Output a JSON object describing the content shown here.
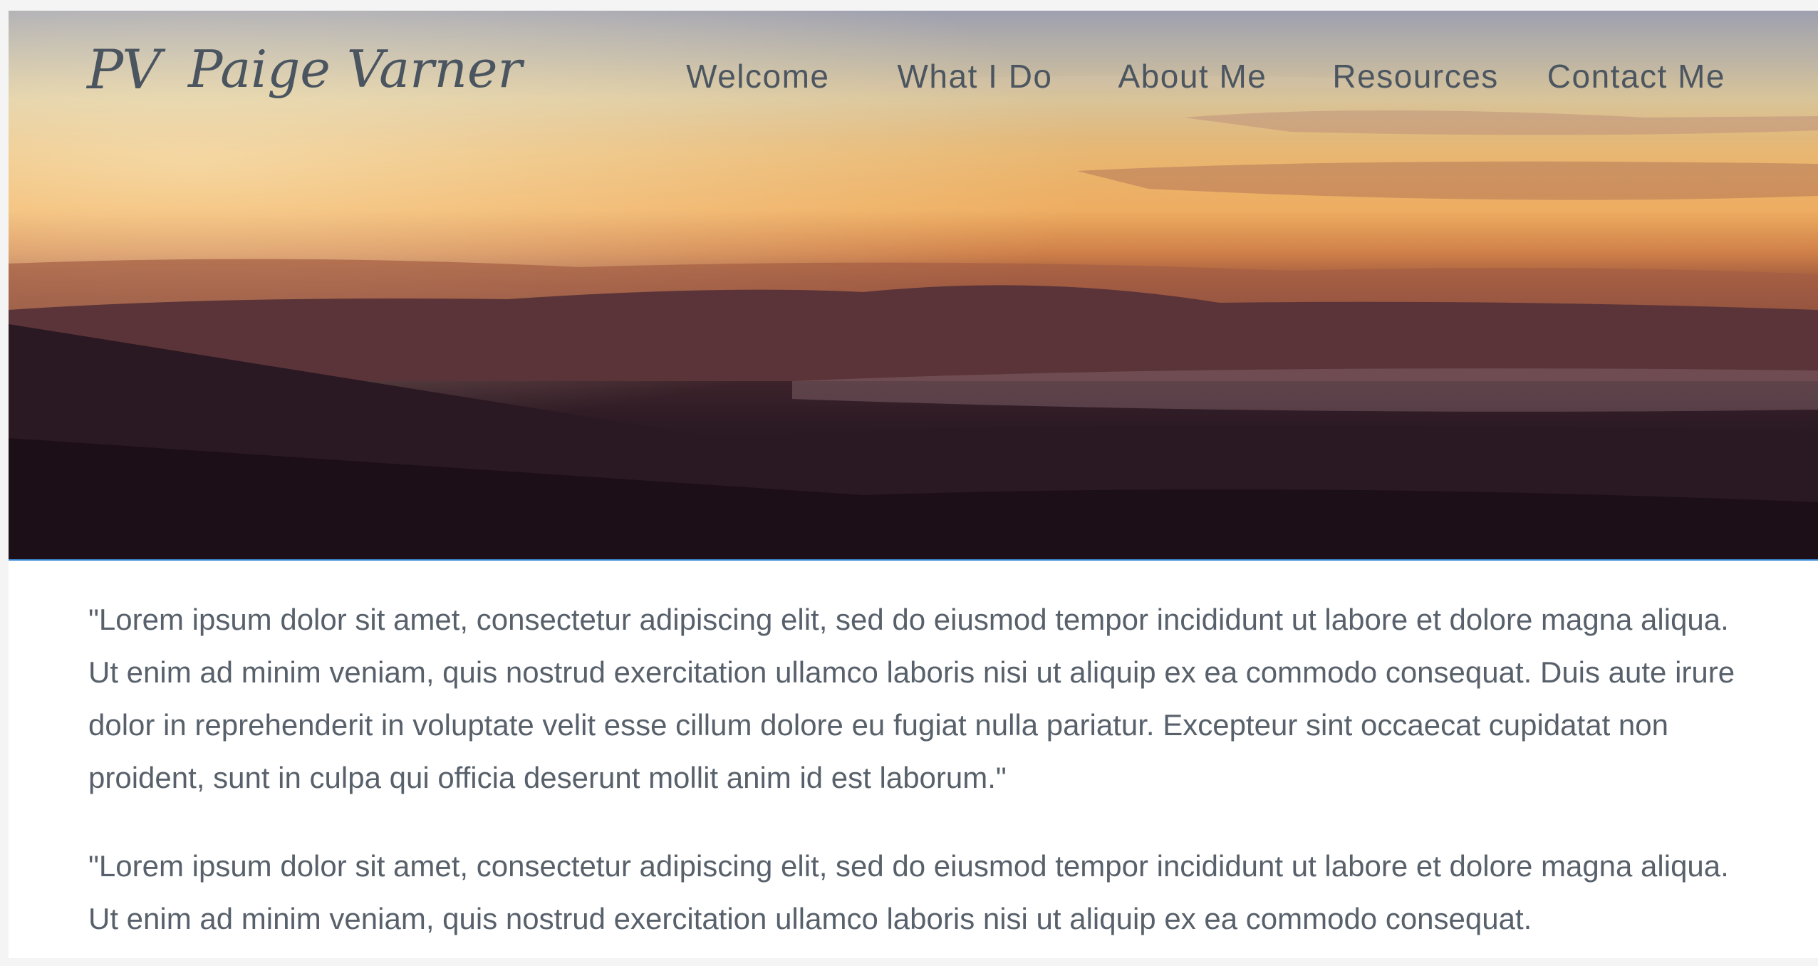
{
  "site": {
    "logo_monogram": "PV",
    "logo_name": "Paige Varner"
  },
  "nav": {
    "items": [
      {
        "label": "Welcome"
      },
      {
        "label": "What I Do"
      },
      {
        "label": "About Me"
      },
      {
        "label": "Resources"
      },
      {
        "label": "Contact Me"
      }
    ]
  },
  "hero": {
    "description_colors": {
      "sky_top": "#9ea0b0",
      "sunset": "#e59a4d",
      "ground": "#1d1018"
    },
    "rule_color": "#3a8bd8"
  },
  "content": {
    "paragraphs": [
      "\"Lorem ipsum dolor sit amet, consectetur adipiscing elit, sed do eiusmod tempor incididunt ut labore et dolore magna aliqua. Ut enim ad minim veniam, quis nostrud exercitation ullamco laboris nisi ut aliquip ex ea commodo consequat. Duis aute irure dolor in reprehenderit in voluptate velit esse cillum dolore eu fugiat nulla pariatur. Excepteur sint occaecat cupidatat non proident, sunt in culpa qui officia deserunt mollit anim id est laborum.\"",
      "\"Lorem ipsum dolor sit amet, consectetur adipiscing elit, sed do eiusmod tempor incididunt ut labore et dolore magna aliqua. Ut enim ad minim veniam, quis nostrud exercitation ullamco laboris nisi ut aliquip ex ea commodo consequat."
    ]
  }
}
